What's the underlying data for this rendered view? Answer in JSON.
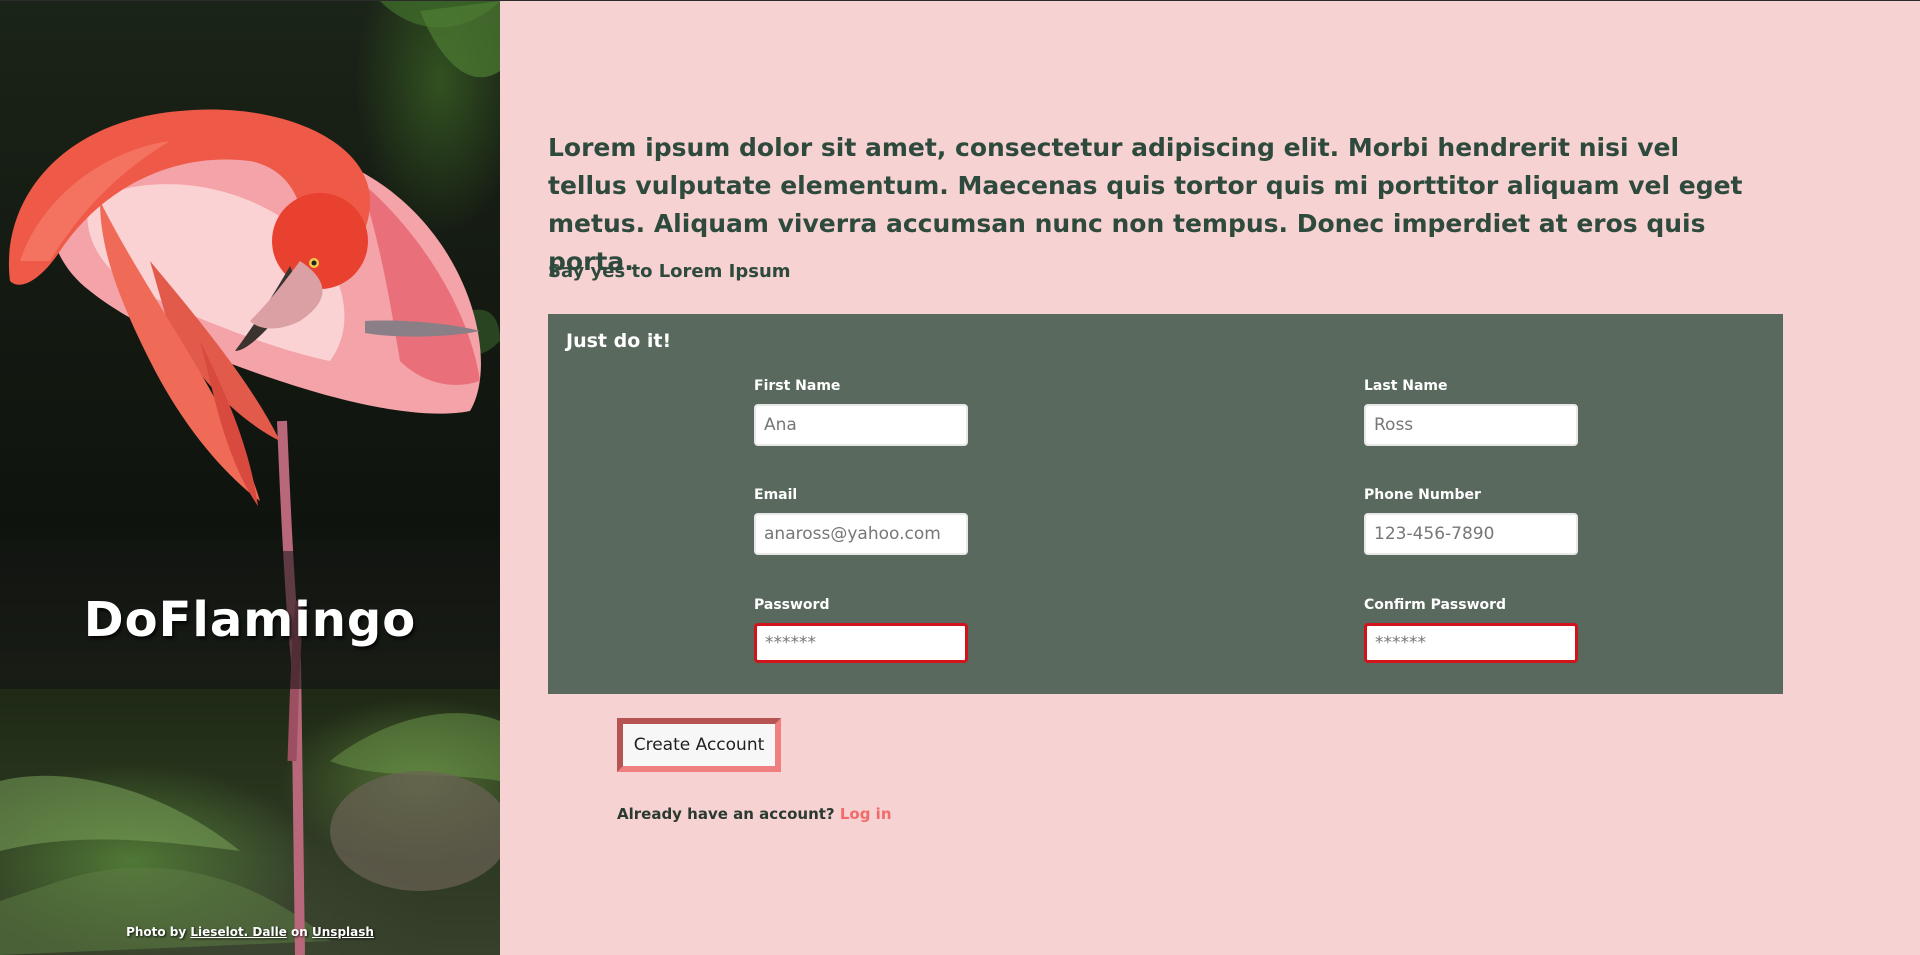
{
  "hero": {
    "site_title": "DoFlamingo",
    "credit_prefix": "Photo by",
    "credit_author": "Lieselot. Dalle",
    "credit_on": "on",
    "credit_site": "Unsplash"
  },
  "intro": {
    "paragraph": "Lorem ipsum dolor sit amet, consectetur adipiscing elit. Morbi hendrerit nisi vel tellus vulputate elementum. Maecenas quis tortor quis mi porttitor aliquam vel eget metus. Aliquam viverra accumsan nunc non tempus. Donec imperdiet at eros quis porta.",
    "tagline": "Say yes to Lorem Ipsum"
  },
  "form": {
    "heading": "Just do it!",
    "first_name": {
      "label": "First Name",
      "placeholder": "Ana"
    },
    "last_name": {
      "label": "Last Name",
      "placeholder": "Ross"
    },
    "email": {
      "label": "Email",
      "placeholder": "anaross@yahoo.com"
    },
    "phone": {
      "label": "Phone Number",
      "placeholder": "123-456-7890"
    },
    "password": {
      "label": "Password",
      "placeholder": "******"
    },
    "confirm_password": {
      "label": "Confirm Password",
      "placeholder": "******"
    },
    "invalid_color": "#d1141b"
  },
  "actions": {
    "create_account": "Create Account",
    "login_prompt": "Already have an account?",
    "login_link": "Log in"
  },
  "colors": {
    "page_bg": "#f7d2d2",
    "panel_bg": "#5a695d",
    "text_dark_green": "#2e4a3c",
    "accent_pink": "#f26b6b"
  }
}
